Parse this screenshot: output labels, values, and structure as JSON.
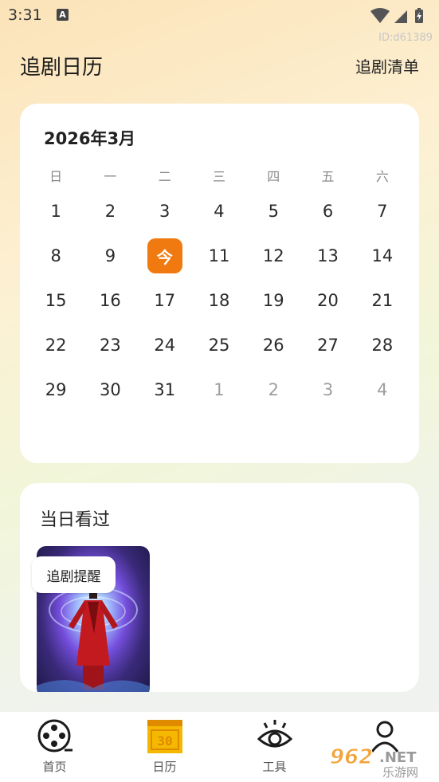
{
  "status_bar": {
    "time": "3:31",
    "a_icon": "A"
  },
  "watermark_id": "ID:d61389",
  "header": {
    "title": "追剧日历",
    "list_link": "追剧清单"
  },
  "calendar": {
    "month_label": "2026年3月",
    "weekdays": [
      "日",
      "一",
      "二",
      "三",
      "四",
      "五",
      "六"
    ],
    "weeks": [
      [
        "1",
        "2",
        "3",
        "4",
        "5",
        "6",
        "7"
      ],
      [
        "8",
        "9",
        "今",
        "11",
        "12",
        "13",
        "14"
      ],
      [
        "15",
        "16",
        "17",
        "18",
        "19",
        "20",
        "21"
      ],
      [
        "22",
        "23",
        "24",
        "25",
        "26",
        "27",
        "28"
      ],
      [
        "29",
        "30",
        "31",
        "1",
        "2",
        "3",
        "4"
      ]
    ],
    "accent_color": "#f07a10"
  },
  "watched": {
    "title": "当日看过",
    "remind_label": "追剧提醒"
  },
  "tabs": [
    {
      "label": "首页",
      "icon": "film-reel-icon"
    },
    {
      "label": "日历",
      "icon": "calendar-icon"
    },
    {
      "label": "工具",
      "icon": "eye-icon"
    },
    {
      "label": "",
      "icon": "person-icon"
    }
  ],
  "watermark_logo": {
    "number": "962",
    "suffix": ".NET",
    "text": "乐游网"
  }
}
